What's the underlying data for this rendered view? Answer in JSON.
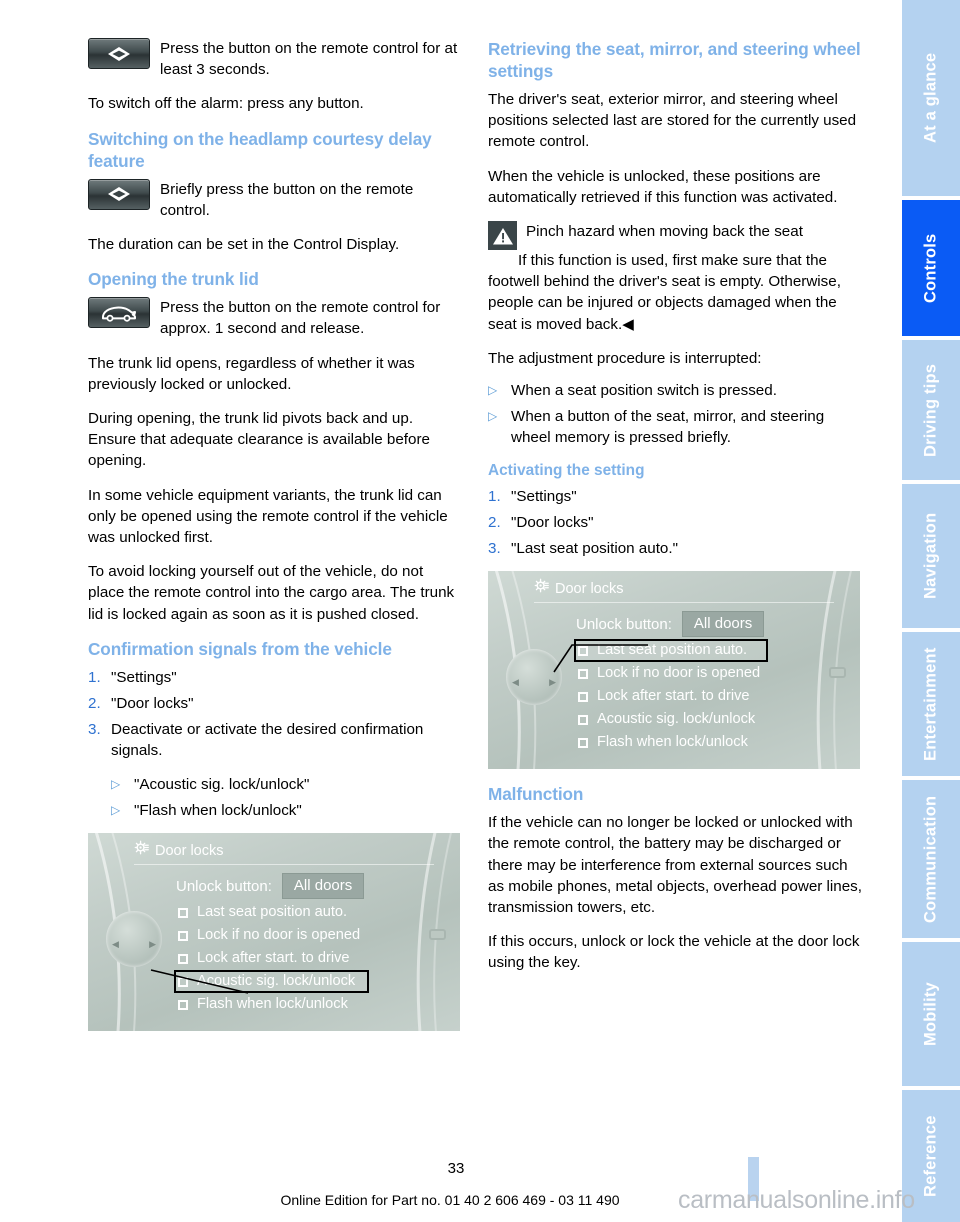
{
  "document": {
    "page_number": "33",
    "footer": "Online Edition for Part no. 01 40 2 606 469 - 03 11 490",
    "watermark": "carmanualsonline.info"
  },
  "sidebar": {
    "tabs": [
      {
        "label": "At a glance",
        "active": false
      },
      {
        "label": "Controls",
        "active": true
      },
      {
        "label": "Driving tips",
        "active": false
      },
      {
        "label": "Navigation",
        "active": false
      },
      {
        "label": "Entertainment",
        "active": false
      },
      {
        "label": "Communication",
        "active": false
      },
      {
        "label": "Mobility",
        "active": false
      },
      {
        "label": "Reference",
        "active": false
      }
    ],
    "colors": {
      "inactive_bg": "#b4d2f0",
      "active_bg": "#0a5bf5",
      "label": "#ffffff"
    }
  },
  "colors": {
    "heading": "#7fb2e8",
    "list_number": "#2f72d0",
    "bullet": "#5b9bd5",
    "body_text": "#000000"
  },
  "left_column": {
    "alarm_icon_block": {
      "icon": "remote-round-button-icon",
      "text": "Press the button on the remote control for at least 3 seconds."
    },
    "alarm_note": "To switch off the alarm: press any button.",
    "headlamp": {
      "heading": "Switching on the headlamp courtesy delay feature",
      "icon": "remote-round-button-icon",
      "icon_text": "Briefly press the button on the remote control.",
      "duration_note": "The duration can be set in the Control Display."
    },
    "trunk": {
      "heading": "Opening the trunk lid",
      "icon": "remote-trunk-button-icon",
      "icon_text": "Press the button on the remote control for approx. 1 second and release.",
      "paragraphs": [
        "The trunk lid opens, regardless of whether it was previously locked or unlocked.",
        "During opening, the trunk lid pivots back and up. Ensure that adequate clearance is available before opening.",
        "In some vehicle equipment variants, the trunk lid can only be opened using the remote control if the vehicle was unlocked first.",
        "To avoid locking yourself out of the vehicle, do not place the remote control into the cargo area. The trunk lid is locked again as soon as it is pushed closed."
      ]
    },
    "confirmation": {
      "heading": "Confirmation signals from the vehicle",
      "steps": [
        {
          "num": "1.",
          "text": "\"Settings\""
        },
        {
          "num": "2.",
          "text": "\"Door locks\""
        },
        {
          "num": "3.",
          "text": "Deactivate or activate the desired confirmation signals."
        }
      ],
      "sub_bullets": [
        "\"Acoustic sig. lock/unlock\"",
        "\"Flash when lock/unlock\""
      ]
    },
    "control_display": {
      "title": "Door locks",
      "title_icon": "settings-gear-icon",
      "unlock_label": "Unlock button:",
      "unlock_value": "All doors",
      "options": [
        {
          "label": "Last seat position auto.",
          "selected": false
        },
        {
          "label": "Lock if no door is opened",
          "selected": false
        },
        {
          "label": "Lock after start. to drive",
          "selected": false
        },
        {
          "label": "Acoustic sig. lock/unlock",
          "selected": true
        },
        {
          "label": "Flash when lock/unlock",
          "selected": false
        }
      ]
    }
  },
  "right_column": {
    "retrieving": {
      "heading": "Retrieving the seat, mirror, and steering wheel settings",
      "paragraphs": [
        "The driver's seat, exterior mirror, and steering wheel positions selected last are stored for the currently used remote control.",
        "When the vehicle is unlocked, these positions are automatically retrieved if this function was activated."
      ]
    },
    "warning": {
      "icon": "warning-triangle-icon",
      "title": "Pinch hazard when moving back the seat",
      "body": "If this function is used, first make sure that the footwell behind the driver's seat is empty. Otherwise, people can be injured or objects damaged when the seat is moved back.◀"
    },
    "interrupt": {
      "intro": "The adjustment procedure is interrupted:",
      "bullets": [
        "When a seat position switch is pressed.",
        "When a button of the seat, mirror, and steering wheel memory is pressed briefly."
      ]
    },
    "activating": {
      "heading": "Activating the setting",
      "steps": [
        {
          "num": "1.",
          "text": "\"Settings\""
        },
        {
          "num": "2.",
          "text": "\"Door locks\""
        },
        {
          "num": "3.",
          "text": "\"Last seat position auto.\""
        }
      ]
    },
    "control_display": {
      "title": "Door locks",
      "title_icon": "settings-gear-icon",
      "unlock_label": "Unlock button:",
      "unlock_value": "All doors",
      "options": [
        {
          "label": "Last seat position auto.",
          "selected": true
        },
        {
          "label": "Lock if no door is opened",
          "selected": false
        },
        {
          "label": "Lock after start. to drive",
          "selected": false
        },
        {
          "label": "Acoustic sig. lock/unlock",
          "selected": false
        },
        {
          "label": "Flash when lock/unlock",
          "selected": false
        }
      ]
    },
    "malfunction": {
      "heading": "Malfunction",
      "paragraphs": [
        "If the vehicle can no longer be locked or unlocked with the remote control, the battery may be discharged or there may be interference from external sources such as mobile phones, metal objects, overhead power lines, transmission towers, etc.",
        "If this occurs, unlock or lock the vehicle at the door lock using the key."
      ]
    }
  }
}
